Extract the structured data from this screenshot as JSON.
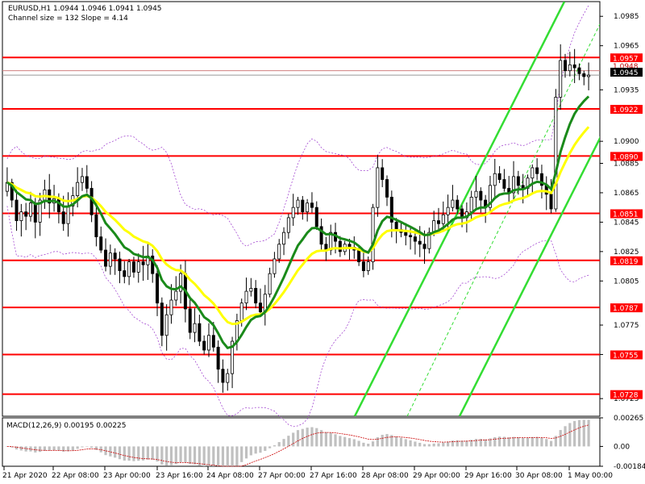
{
  "header": {
    "symbol_line": "EURUSD,H1  1.0944 1.0946 1.0941 1.0945",
    "channel_line": "Channel size = 132 Slope = 4.14"
  },
  "macd_label": "MACD(12,26,9) 0.00195 0.00225",
  "current_price": "1.0945",
  "hidden_level_label": "1.0948",
  "colors": {
    "level": "#ff0000",
    "ema_fast": "#1a8a1a",
    "ema_slow": "#ffff00",
    "channel": "#33dd33",
    "bollinger": "#9933cc",
    "candle": "#000000",
    "macd_hist": "#c0c0c0",
    "macd_signal": "#cc0000"
  },
  "chart_data": {
    "type": "candlestick",
    "symbol": "EURUSD",
    "timeframe": "H1",
    "ylim": [
      1.0713,
      1.0995
    ],
    "y_ticks": [
      "1.0985",
      "1.0965",
      "1.0935",
      "1.0900",
      "1.0885",
      "1.0865",
      "1.0845",
      "1.0825",
      "1.0805",
      "1.0775",
      "1.0755",
      "1.0725"
    ],
    "x_ticks": [
      "21 Apr 2020",
      "22 Apr 08:00",
      "23 Apr 00:00",
      "23 Apr 16:00",
      "24 Apr 08:00",
      "27 Apr 00:00",
      "27 Apr 16:00",
      "28 Apr 08:00",
      "29 Apr 00:00",
      "29 Apr 16:00",
      "30 Apr 08:00",
      "1 May 00:00"
    ],
    "levels": [
      "1.0957",
      "1.0922",
      "1.0890",
      "1.0851",
      "1.0819",
      "1.0787",
      "1.0755",
      "1.0728"
    ],
    "close": [
      1.0872,
      1.086,
      1.0846,
      1.0852,
      1.0849,
      1.0858,
      1.0845,
      1.086,
      1.0867,
      1.0858,
      1.0861,
      1.0852,
      1.0844,
      1.0856,
      1.0863,
      1.0872,
      1.0876,
      1.0868,
      1.085,
      1.0835,
      1.0826,
      1.0815,
      1.0824,
      1.082,
      1.0812,
      1.0808,
      1.0818,
      1.0811,
      1.0818,
      1.0816,
      1.0822,
      1.081,
      1.079,
      1.0768,
      1.0782,
      1.0792,
      1.0798,
      1.081,
      1.0786,
      1.077,
      1.0776,
      1.0764,
      1.0758,
      1.0768,
      1.076,
      1.0745,
      1.0736,
      1.0742,
      1.0764,
      1.0778,
      1.079,
      1.0798,
      1.08,
      1.079,
      1.0784,
      1.0796,
      1.081,
      1.082,
      1.083,
      1.0838,
      1.0848,
      1.0855,
      1.086,
      1.0852,
      1.0858,
      1.0855,
      1.0842,
      1.083,
      1.0826,
      1.0838,
      1.0832,
      1.0825,
      1.083,
      1.0828,
      1.0826,
      1.0818,
      1.0812,
      1.0818,
      1.0855,
      1.0882,
      1.0874,
      1.0862,
      1.0845,
      1.084,
      1.0838,
      1.0836,
      1.0835,
      1.0832,
      1.083,
      1.0827,
      1.0838,
      1.0846,
      1.0844,
      1.085,
      1.0855,
      1.086,
      1.0854,
      1.0848,
      1.0852,
      1.0862,
      1.0866,
      1.086,
      1.0855,
      1.087,
      1.0878,
      1.0874,
      1.0868,
      1.0865,
      1.0876,
      1.087,
      1.0868,
      1.0875,
      1.0882,
      1.0878,
      1.087,
      1.0864,
      1.0854,
      1.093,
      1.0955,
      1.0948,
      1.0952,
      1.095,
      1.0946,
      1.0944,
      1.0945
    ],
    "ema_fast_period": 50,
    "ema_slow_period": 100,
    "macd": {
      "params": "12,26,9",
      "y_ticks": [
        "0.00265",
        "0.00",
        "-0.00184"
      ],
      "ylim": [
        -0.00184,
        0.00265
      ]
    }
  }
}
